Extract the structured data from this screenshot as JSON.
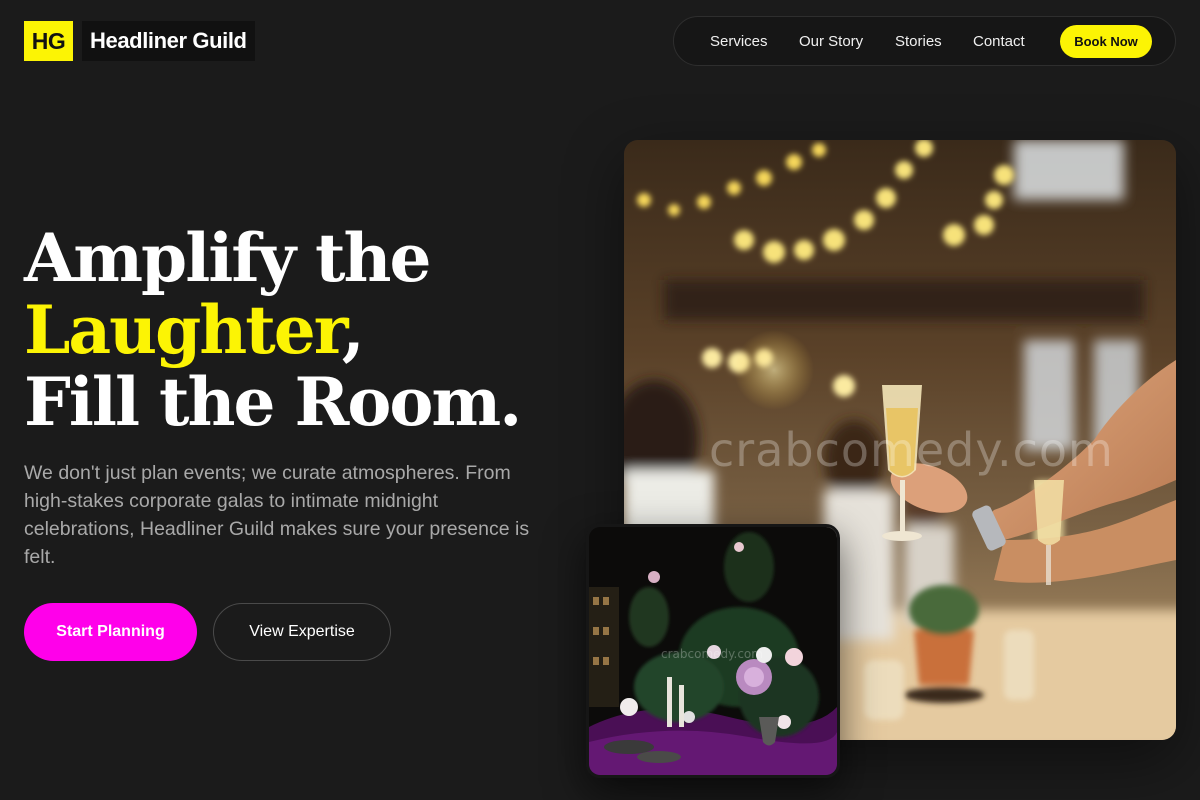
{
  "brand": {
    "mark": "HG",
    "name": "Headliner Guild"
  },
  "nav": {
    "items": [
      {
        "label": "Services"
      },
      {
        "label": "Our Story"
      },
      {
        "label": "Stories"
      },
      {
        "label": "Contact"
      }
    ],
    "cta_label": "Book Now"
  },
  "hero": {
    "headline_line1": "Amplify the",
    "headline_accent": "Laughter",
    "headline_comma": ",",
    "headline_line3": "Fill the Room.",
    "description": "We don't just plan events; we curate atmospheres. From high-stakes corporate galas to intimate midnight celebrations, Headliner Guild makes sure your presence is felt.",
    "primary_button": "Start Planning",
    "secondary_button": "View Expertise"
  },
  "images": {
    "main_watermark": "crabcomedy.com",
    "small_watermark": "crabcomedy.com"
  },
  "colors": {
    "accent_yellow": "#fcf404",
    "accent_magenta": "#ff00ea",
    "background": "#1b1b1b"
  }
}
